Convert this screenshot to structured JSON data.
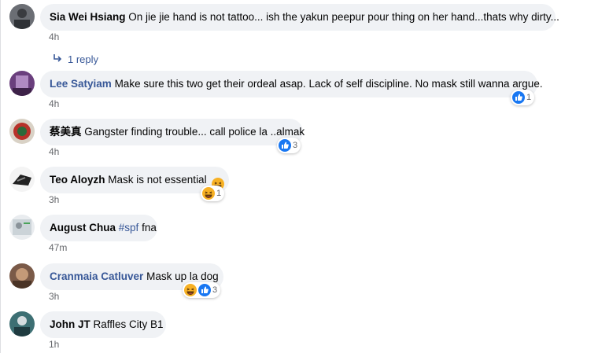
{
  "comments": [
    {
      "author": "Sia Wei Hsiang",
      "text": "On jie jie hand is not tattoo... ish the yakun peepur pour thing on her hand...thats why dirty...",
      "time": "4h",
      "reply_label": "1 reply"
    },
    {
      "author": "Lee Satyiam",
      "text": "Make sure this two get their ordeal asap. Lack of self discipline. No mask still wanna argue.",
      "time": "4h",
      "reaction_count": "1",
      "reactions": [
        "like-icon"
      ]
    },
    {
      "author": "蔡美真",
      "text": "Gangster finding trouble... call police la ..almak",
      "time": "4h",
      "reaction_count": "3",
      "reactions": [
        "like-icon"
      ]
    },
    {
      "author": "Teo Aloyzh",
      "text": "Mask is not essential",
      "time": "3h",
      "reaction_count": "1",
      "reactions": [
        "haha-icon"
      ],
      "inline_emoji": "laughing-emoji"
    },
    {
      "author": "August Chua",
      "tag": "#spf",
      "text": "fna",
      "time": "47m"
    },
    {
      "author": "Cranmaia Catluver",
      "text": "Mask up la dog",
      "time": "3h",
      "reaction_count": "3",
      "reactions": [
        "haha-icon",
        "like-icon"
      ]
    },
    {
      "author": "John JT",
      "text": "Raffles City B1",
      "time": "1h"
    }
  ],
  "colors": {
    "bubble": "#f0f2f5",
    "link": "#385898",
    "meta": "#65676b",
    "like": "#1877f2",
    "haha": "#f7b125"
  }
}
